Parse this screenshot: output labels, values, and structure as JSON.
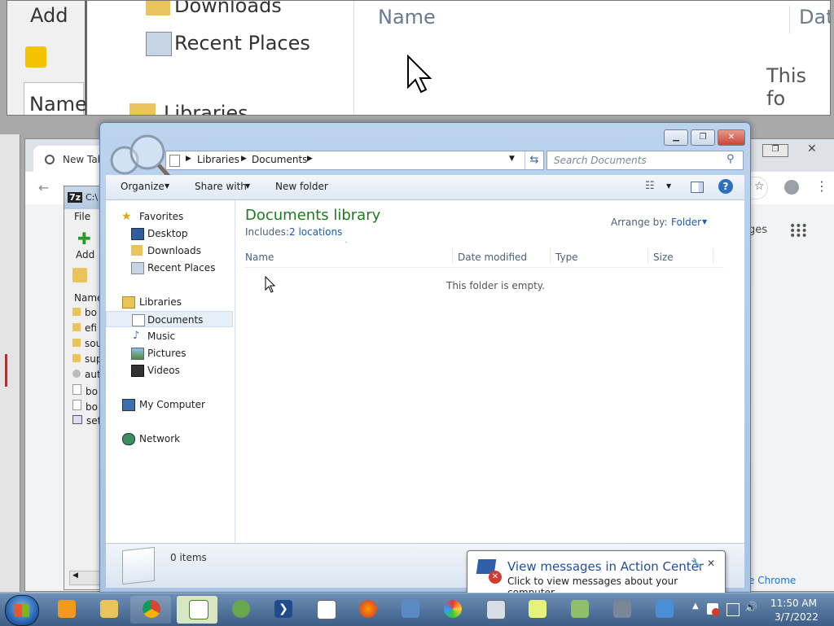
{
  "zoom": {
    "add_label": "Add",
    "downloads": "Downloads",
    "recent_places": "Recent Places",
    "name_col": "Name",
    "libraries": "Libraries",
    "name_col_right": "Name",
    "date_col": "Dat",
    "empty_text": "This fo"
  },
  "chrome": {
    "tab_title": "New Tab",
    "menu_fragment": "ges",
    "promo_fragment": "e Chrome"
  },
  "sevenzip": {
    "title": "C:\\",
    "menu_file": "File",
    "add_label": "Add",
    "col_name": "Name",
    "rows": [
      "bo",
      "efi",
      "sou",
      "sup",
      "aut",
      "bo",
      "bo",
      "set"
    ]
  },
  "explorer": {
    "breadcrumb": [
      "Libraries",
      "Documents"
    ],
    "search_placeholder": "Search Documents",
    "toolbar": {
      "organize": "Organize",
      "share_with": "Share with",
      "new_folder": "New folder"
    },
    "nav": {
      "favorites": "Favorites",
      "desktop": "Desktop",
      "downloads": "Downloads",
      "recent_places": "Recent Places",
      "libraries": "Libraries",
      "documents": "Documents",
      "music": "Music",
      "pictures": "Pictures",
      "videos": "Videos",
      "my_computer": "My Computer",
      "network": "Network"
    },
    "library_title": "Documents library",
    "includes_label": "Includes:",
    "includes_link": "2 locations",
    "arrange_by_label": "Arrange by:",
    "arrange_by_value": "Folder",
    "columns": [
      "Name",
      "Date modified",
      "Type",
      "Size"
    ],
    "empty_message": "This folder is empty.",
    "item_count": "0 items"
  },
  "balloon": {
    "title": "View messages in Action Center",
    "body": "Click to view messages about your computer."
  },
  "clock": {
    "time": "11:50 AM",
    "date": "3/7/2022"
  },
  "colors": {
    "library_title": "#1e7a1e",
    "link": "#1a5ab8",
    "taskbar": "#3c5d86"
  }
}
